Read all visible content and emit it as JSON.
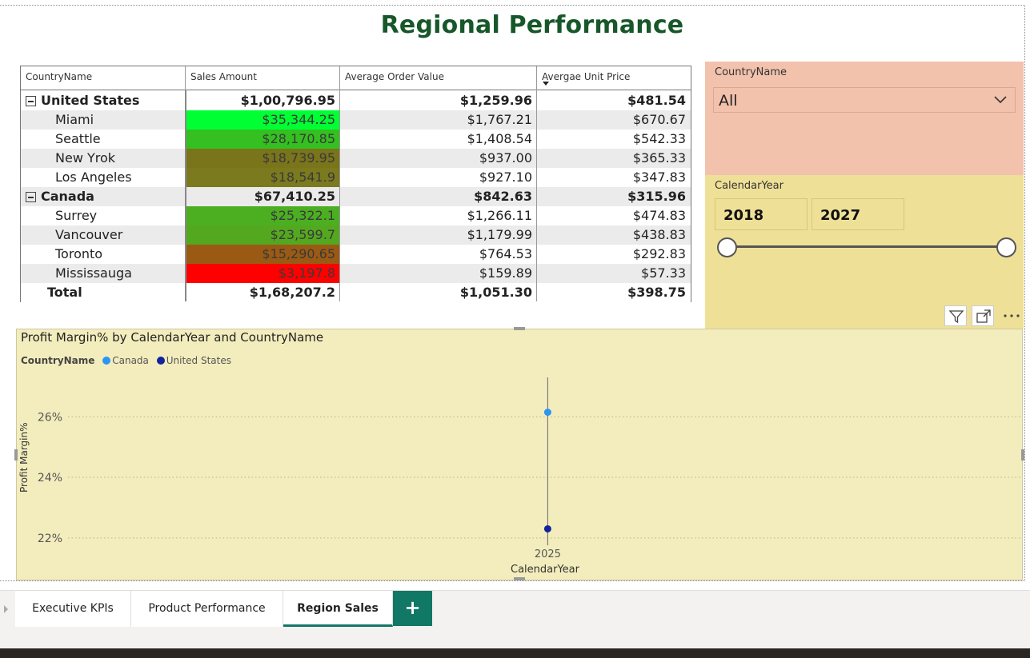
{
  "report": {
    "title": "Regional Performance"
  },
  "matrix": {
    "headers": [
      "CountryName",
      "Sales Amount",
      "Average Order Value",
      "Avergae Unit Price"
    ],
    "rows": [
      {
        "label": "United States",
        "type": "group",
        "sales": "$1,00,796.95",
        "aov": "$1,259.96",
        "aup": "$481.54",
        "bg": "#ffffff"
      },
      {
        "label": "Miami",
        "type": "city",
        "sales": "$35,344.25",
        "aov": "$1,767.21",
        "aup": "$670.67",
        "bg": "#ebebeb",
        "sales_color": "#00ff33"
      },
      {
        "label": "Seattle",
        "type": "city",
        "sales": "$28,170.85",
        "aov": "$1,408.54",
        "aup": "$542.33",
        "bg": "#ffffff",
        "sales_color": "#33c020"
      },
      {
        "label": "New Yrok",
        "type": "city",
        "sales": "$18,739.95",
        "aov": "$937.00",
        "aup": "$365.33",
        "bg": "#ebebeb",
        "sales_color": "#7a741b"
      },
      {
        "label": "Los Angeles",
        "type": "city",
        "sales": "$18,541.9",
        "aov": "$927.10",
        "aup": "$347.83",
        "bg": "#ffffff",
        "sales_color": "#7b7a1e"
      },
      {
        "label": "Canada",
        "type": "group",
        "sales": "$67,410.25",
        "aov": "$842.63",
        "aup": "$315.96",
        "bg": "#ebebeb"
      },
      {
        "label": "Surrey",
        "type": "city",
        "sales": "$25,322.1",
        "aov": "$1,266.11",
        "aup": "$474.83",
        "bg": "#ffffff",
        "sales_color": "#4baf21"
      },
      {
        "label": "Vancouver",
        "type": "city",
        "sales": "$23,599.7",
        "aov": "$1,179.99",
        "aup": "$438.83",
        "bg": "#ebebeb",
        "sales_color": "#54a820"
      },
      {
        "label": "Toronto",
        "type": "city",
        "sales": "$15,290.65",
        "aov": "$764.53",
        "aup": "$292.83",
        "bg": "#ffffff",
        "sales_color": "#9a5a14"
      },
      {
        "label": "Mississauga",
        "type": "city",
        "sales": "$3,197.8",
        "aov": "$159.89",
        "aup": "$57.33",
        "bg": "#ebebeb",
        "sales_color": "#ff0000"
      },
      {
        "label": "Total",
        "type": "total",
        "sales": "$1,68,207.2",
        "aov": "$1,051.30",
        "aup": "$398.75",
        "bg": "#ffffff"
      }
    ]
  },
  "slicers": {
    "country": {
      "label": "CountryName",
      "value": "All"
    },
    "year": {
      "label": "CalendarYear",
      "from": "2018",
      "to": "2027"
    }
  },
  "chart_data": {
    "type": "scatter",
    "title": "Profit Margin% by CalendarYear and CountryName",
    "legend_title": "CountryName",
    "xlabel": "CalendarYear",
    "ylabel": "Profit Margin%",
    "x_ticks": [
      "2025"
    ],
    "y_ticks": [
      "22%",
      "24%",
      "26%"
    ],
    "ylim": [
      21.6,
      27.3
    ],
    "grid": true,
    "legend_position": "top-left",
    "series": [
      {
        "name": "Canada",
        "color": "#2b95f3",
        "points": [
          {
            "x": "2025",
            "y": 26.15
          }
        ]
      },
      {
        "name": "United States",
        "color": "#12239e",
        "points": [
          {
            "x": "2025",
            "y": 22.3
          }
        ]
      }
    ]
  },
  "tabs": [
    {
      "label": "Executive KPIs",
      "active": false
    },
    {
      "label": "Product Performance",
      "active": false
    },
    {
      "label": "Region Sales",
      "active": true
    }
  ],
  "add_tab_label": "+",
  "colors": {
    "title": "#17572a",
    "tab_accent": "#117865",
    "slicer_country_bg": "#f2c2ad",
    "slicer_year_bg": "#efe097",
    "chart_bg": "#f3edbd"
  }
}
